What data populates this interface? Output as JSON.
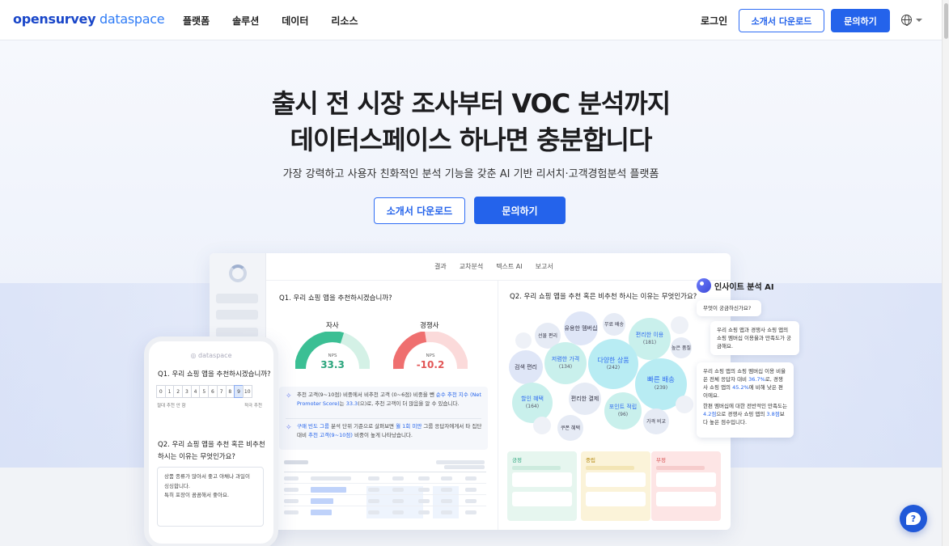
{
  "nav": {
    "logo_a": "opensurvey",
    "logo_b": " dataspace",
    "menu": [
      "플랫폼",
      "솔루션",
      "데이터",
      "리소스"
    ],
    "login": "로그인",
    "download": "소개서 다운로드",
    "contact": "문의하기",
    "language_icon": "globe-icon"
  },
  "hero": {
    "title_line1": "출시 전 시장 조사부터 VOC 분석까지",
    "title_line2": "데이터스페이스 하나면 충분합니다",
    "subtitle": "가장 강력하고 사용자 친화적인 분석 기능을 갖춘 AI 기반 리서치·고객경험분석 플랫폼",
    "download": "소개서 다운로드",
    "contact": "문의하기"
  },
  "dashboard": {
    "tabs": [
      "결과",
      "교차분석",
      "텍스트 AI",
      "보고서"
    ],
    "q1": "Q1. 우리 쇼핑 앱을 추천하시겠습니까?",
    "q2": "Q2. 우리 쇼핑 앱을 추천 혹은 비추천 하시는 이유는 무엇인가요?",
    "gauge_self": {
      "label": "자사",
      "nps_label": "NPS",
      "value": "33.3",
      "color": "#3bbf94"
    },
    "gauge_comp": {
      "label": "경쟁사",
      "nps_label": "NPS",
      "value": "-10.2",
      "color": "#ef6f6f"
    },
    "insight1_a": "추천 고객(9~10점) 비중에서 비추천 고객 (0~6점) 비중을 뺀 ",
    "insight1_b": "순수 추천 지수 (Net Promoter Score)",
    "insight1_c": "는 ",
    "insight1_d": "33.3",
    "insight1_e": "(으)로, 추천 고객이 더 많음을 알 수 있습니다.",
    "insight2_a": "구매 빈도 그룹",
    "insight2_b": " 분석 단위 기준으로 살펴보면 ",
    "insight2_c": "월 1회 미만",
    "insight2_d": " 그룹 응답자에게서 타 집단 대비 ",
    "insight2_e": "추천 고객(9~10점)",
    "insight2_f": " 비중이 높게 나타났습니다.",
    "bubbles": [
      {
        "text": "유용한 멤버십",
        "count": ""
      },
      {
        "text": "무료 배송",
        "count": ""
      },
      {
        "text": "선물 편리",
        "count": ""
      },
      {
        "text": "편리한 이용",
        "count": "(181)"
      },
      {
        "text": "높은 품질",
        "count": ""
      },
      {
        "text": "검색 편리",
        "count": ""
      },
      {
        "text": "저렴한 가격",
        "count": "(134)"
      },
      {
        "text": "다양한 상품",
        "count": "(242)"
      },
      {
        "text": "빠른 배송",
        "count": "(239)"
      },
      {
        "text": "할인 혜택",
        "count": "(164)"
      },
      {
        "text": "편리한 결제",
        "count": ""
      },
      {
        "text": "포인트 적립",
        "count": "(96)"
      },
      {
        "text": "쿠폰 혜택",
        "count": ""
      },
      {
        "text": "가격 비교",
        "count": ""
      }
    ],
    "sentiment": {
      "positive": "긍정",
      "neutral": "중립",
      "negative": "부정"
    }
  },
  "ai_panel": {
    "title": "인사이트 분석 AI",
    "prompt": "무엇이 궁금하신가요?",
    "question": "우리 쇼핑 앱과 경쟁사 쇼핑 앱의 쇼핑 멤버십 이용율과 만족도가 궁금해요.",
    "answer_a": "우리 쇼핑 앱의 쇼핑 멤버십 이용 비율은 전체 응답자 대비 ",
    "answer_b": "36.7%",
    "answer_c": "로, 경쟁사 쇼핑 앱의 ",
    "answer_d": "45.2%",
    "answer_e": "에 비해 낮은 편이에요.",
    "answer2_a": "한편 멤버십에 대한 전반적인 만족도는 ",
    "answer2_b": "4.2점",
    "answer2_c": "으로 경쟁사 쇼핑 앱의 ",
    "answer2_d": "3.8점",
    "answer2_e": "보다 높은 점수입니다."
  },
  "phone": {
    "logo": "◎ dataspace",
    "q1": "Q1. 우리 쇼핑 앱을 추천하시겠습니까?",
    "scale": [
      "0",
      "1",
      "2",
      "3",
      "4",
      "5",
      "6",
      "7",
      "8",
      "9",
      "10"
    ],
    "selected": "9",
    "scale_low": "절대 추천 안 함",
    "scale_high": "적극 추천",
    "q2": "Q2. 우리 쇼핑 앱을 추천 혹은 비추천 하시는 이유는 무엇인가요?",
    "answer_line1": "상품 종류가 많아서 좋고 야채나 과일이",
    "answer_line2": "싱싱합니다.",
    "answer_line3": "특히 포장이 꼼꼼해서 좋아요."
  },
  "fab": {
    "glyph": "?"
  }
}
